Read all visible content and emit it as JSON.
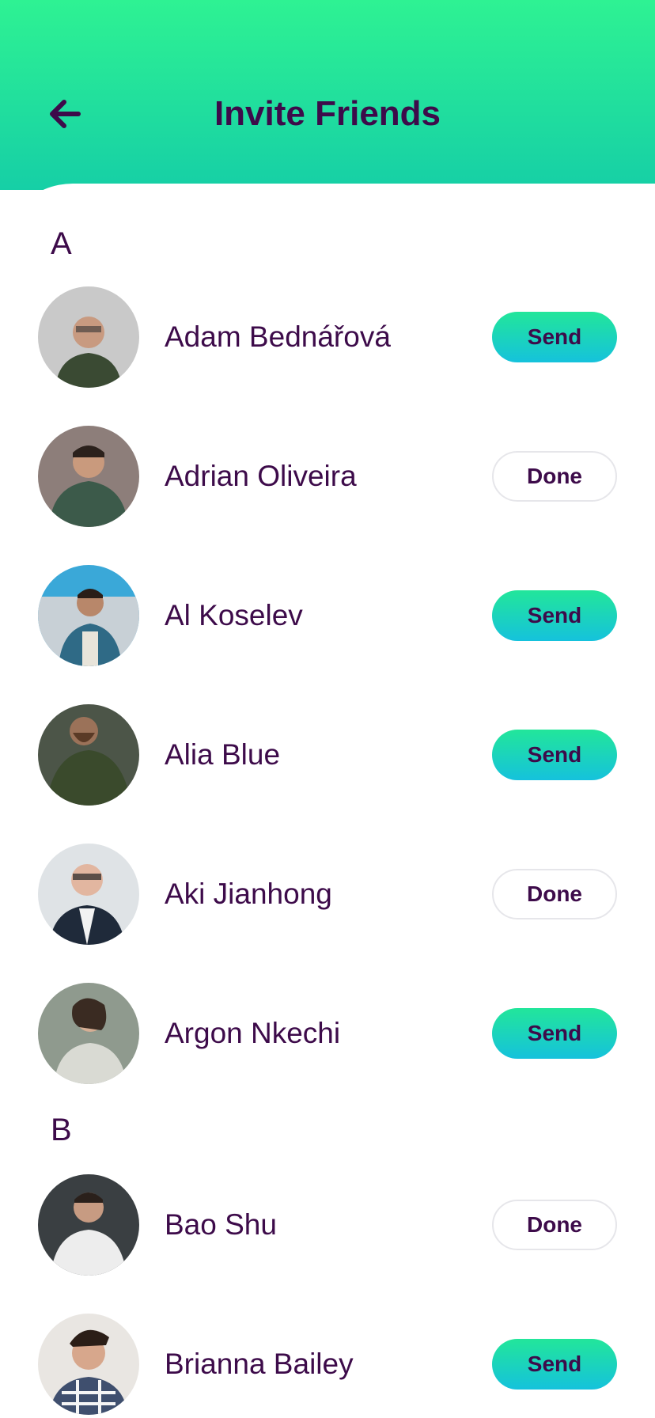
{
  "header": {
    "title": "Invite Friends",
    "back_icon": "arrow-left-icon"
  },
  "colors": {
    "header_gradient_top": "#2ef293",
    "header_gradient_bottom": "#16cfa6",
    "text_primary": "#3d0b4a",
    "send_gradient_top": "#22e69a",
    "send_gradient_bottom": "#15c2dc",
    "done_border": "#e6e6ea"
  },
  "sections": [
    {
      "letter": "A",
      "contacts": [
        {
          "name": "Adam Bednářová",
          "action": "Send"
        },
        {
          "name": "Adrian Oliveira",
          "action": "Done"
        },
        {
          "name": "Al Koselev",
          "action": "Send"
        },
        {
          "name": "Alia Blue",
          "action": "Send"
        },
        {
          "name": "Aki Jianhong",
          "action": "Done"
        },
        {
          "name": "Argon Nkechi",
          "action": "Send"
        }
      ]
    },
    {
      "letter": "B",
      "contacts": [
        {
          "name": "Bao Shu",
          "action": "Done"
        },
        {
          "name": "Brianna Bailey",
          "action": "Send"
        }
      ]
    }
  ]
}
